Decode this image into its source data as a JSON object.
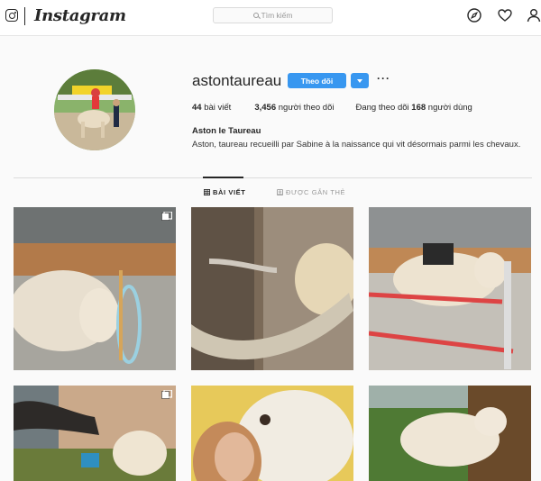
{
  "nav": {
    "brand": "Instagram",
    "search_placeholder": "Tìm kiếm",
    "icons": [
      "instagram-glyph-icon",
      "compass-icon",
      "heart-icon",
      "user-icon"
    ]
  },
  "profile": {
    "username": "astontaureau",
    "follow_label": "Theo dõi",
    "more_label": "···",
    "stats": {
      "posts_count": "44",
      "posts_label": "bài viết",
      "followers_count": "3,456",
      "followers_label": "người theo dõi",
      "following_prefix": "Đang theo dõi",
      "following_count": "168",
      "following_label": "người dùng"
    },
    "display_name": "Aston le Taureau",
    "bio": "Aston, taureau recueilli par Sabine à la naissance qui vit désormais parmi les chevaux."
  },
  "tabs": [
    {
      "label": "BÀI VIẾT",
      "active": true,
      "icon": "grid-icon"
    },
    {
      "label": "ĐƯỢC GẮN THẺ",
      "active": false,
      "icon": "tag-icon"
    }
  ],
  "posts": [
    {
      "subject": "bull with hoop in arena",
      "multi": true
    },
    {
      "subject": "horn closeup with woman",
      "multi": false
    },
    {
      "subject": "bull jumping poles in arena",
      "multi": false
    },
    {
      "subject": "horse and bull outdoors",
      "multi": true
    },
    {
      "subject": "woman kissing bull",
      "multi": false
    },
    {
      "subject": "bull on grass",
      "multi": false
    }
  ],
  "colors": {
    "accent": "#3897f0",
    "border": "#dbdbdb",
    "text": "#262626",
    "muted": "#999999"
  }
}
